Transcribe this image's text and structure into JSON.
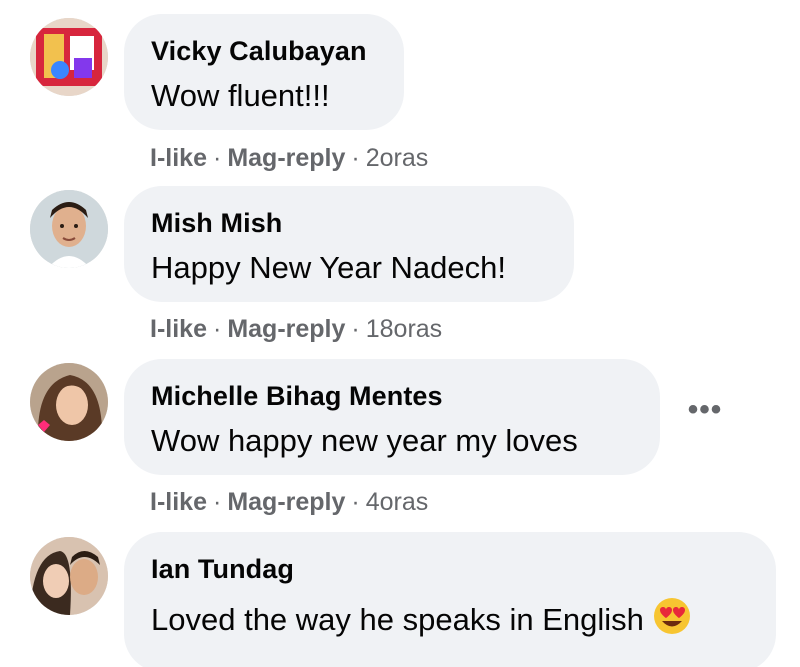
{
  "comments": [
    {
      "author": "Vicky Calubayan",
      "text": "Wow fluent!!!",
      "like_label": "I-like",
      "reply_label": "Mag-reply",
      "time": "2oras"
    },
    {
      "author": "Mish Mish",
      "text": "Happy New Year Nadech!",
      "like_label": "I-like",
      "reply_label": "Mag-reply",
      "time": "18oras"
    },
    {
      "author": "Michelle Bihag Mentes",
      "text": "Wow happy new year my loves",
      "like_label": "I-like",
      "reply_label": "Mag-reply",
      "time": "4oras"
    },
    {
      "author": "Ian Tundag",
      "text": "Loved the way he speaks in English",
      "emoji": "heart-eyes-emoji"
    }
  ],
  "separator": "·",
  "more_icon": "more-options-icon",
  "colors": {
    "bubble": "#f0f2f5",
    "text": "#050505",
    "secondary": "#65676b"
  }
}
